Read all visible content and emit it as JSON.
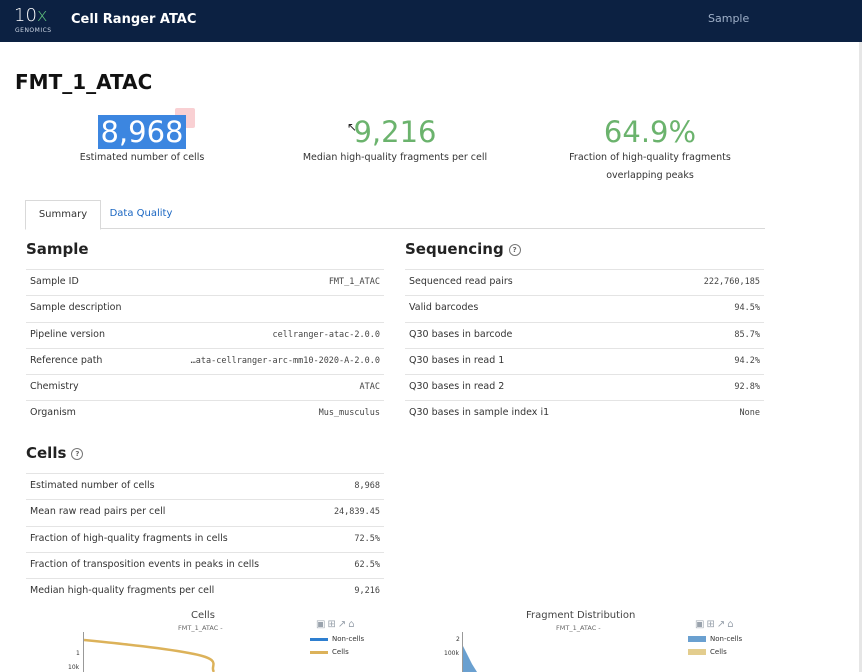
{
  "header": {
    "logo_main": "10",
    "logo_x": "x",
    "logo_sub": "GENOMICS",
    "app_title": "Cell Ranger ATAC",
    "nav_sample": "Sample"
  },
  "page_title": "FMT_1_ATAC",
  "metrics": [
    {
      "value": "8,968",
      "label": "Estimated number of cells"
    },
    {
      "value": "9,216",
      "label": "Median high-quality fragments per cell"
    },
    {
      "value": "64.9%",
      "label_line1": "Fraction of high-quality fragments",
      "label_line2": "overlapping peaks"
    }
  ],
  "tabs": {
    "summary": "Summary",
    "data_quality": "Data Quality"
  },
  "sample": {
    "title": "Sample",
    "rows": [
      {
        "k": "Sample ID",
        "v": "FMT_1_ATAC"
      },
      {
        "k": "Sample description",
        "v": ""
      },
      {
        "k": "Pipeline version",
        "v": "cellranger-atac-2.0.0"
      },
      {
        "k": "Reference path",
        "v": "…ata-cellranger-arc-mm10-2020-A-2.0.0"
      },
      {
        "k": "Chemistry",
        "v": "ATAC"
      },
      {
        "k": "Organism",
        "v": "Mus_musculus"
      }
    ]
  },
  "sequencing": {
    "title": "Sequencing",
    "rows": [
      {
        "k": "Sequenced read pairs",
        "v": "222,760,185"
      },
      {
        "k": "Valid barcodes",
        "v": "94.5%"
      },
      {
        "k": "Q30 bases in barcode",
        "v": "85.7%"
      },
      {
        "k": "Q30 bases in read 1",
        "v": "94.2%"
      },
      {
        "k": "Q30 bases in read 2",
        "v": "92.8%"
      },
      {
        "k": "Q30 bases in sample index i1",
        "v": "None"
      }
    ]
  },
  "cells": {
    "title": "Cells",
    "rows": [
      {
        "k": "Estimated number of cells",
        "v": "8,968"
      },
      {
        "k": "Mean raw read pairs per cell",
        "v": "24,839.45"
      },
      {
        "k": "Fraction of high-quality fragments in cells",
        "v": "72.5%"
      },
      {
        "k": "Fraction of transposition events in peaks in cells",
        "v": "62.5%"
      },
      {
        "k": "Median high-quality fragments per cell",
        "v": "9,216"
      }
    ]
  },
  "charts": {
    "cells": {
      "title": "Cells",
      "subtitle": "FMT_1_ATAC -",
      "legend": [
        {
          "name": "Non-cells",
          "color": "#2e7fd0"
        },
        {
          "name": "Cells",
          "color": "#dcb25a"
        }
      ],
      "ticks": [
        "1",
        "10k"
      ]
    },
    "fragments": {
      "title": "Fragment Distribution",
      "subtitle": "FMT_1_ATAC -",
      "legend": [
        {
          "name": "Non-cells",
          "color": "#6aa0d0"
        },
        {
          "name": "Cells",
          "color": "#e3cd8e"
        }
      ],
      "ticks": [
        "2",
        "100k"
      ]
    }
  },
  "toolbar_icons": [
    "camera-icon",
    "zoom-box-icon",
    "pan-icon",
    "home-icon"
  ],
  "colors": {
    "header_bg": "#0c2142",
    "metric_green": "#6bb36d",
    "link_blue": "#1a66c2"
  }
}
